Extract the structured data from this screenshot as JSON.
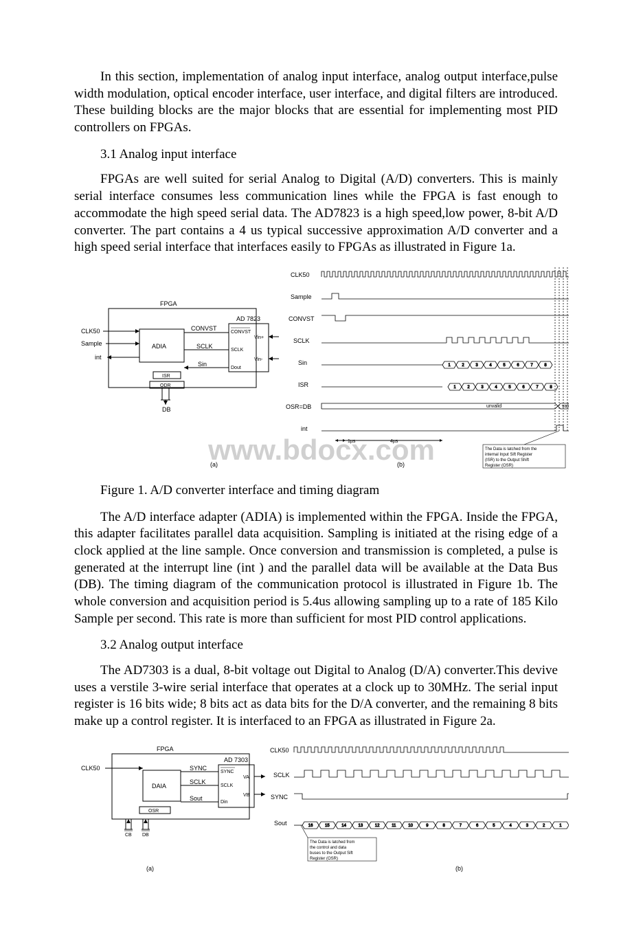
{
  "para_intro": "In this section, implementation of analog input interface, analog output interface,pulse width modulation, optical encoder interface, user interface, and digital filters are introduced. These building blocks are the major blocks that are essential for implementing most PID controllers on FPGAs.",
  "heading_31": "3.1 Analog input interface",
  "para_31": "FPGAs are well suited for serial Analog to Digital (A/D) converters. This is mainly serial interface consumes less communication lines while the FPGA is fast enough to accommodate the high speed serial data. The AD7823 is a high speed,low power, 8-bit A/D converter. The part contains a 4 us typical successive approximation A/D converter and a high speed serial interface that interfaces easily to FPGAs as illustrated in Figure 1a.",
  "fig1_caption": "Figure 1. A/D converter interface and timing diagram",
  "para_31b": "The A/D interface adapter (ADIA) is implemented within the FPGA. Inside the FPGA, this adapter facilitates parallel data acquisition. Sampling is initiated at the rising edge of a clock applied at the line sample. Once conversion and transmission is completed, a pulse is generated at the interrupt line (int ) and the parallel data will be available at the Data Bus (DB). The timing diagram of the communication protocol is illustrated in Figure 1b. The whole conversion and acquisition period is 5.4us allowing sampling up to a rate of 185 Kilo Sample per second. This rate is more than sufficient for most PID control applications.",
  "heading_32": "3.2 Analog output interface",
  "para_32": "The AD7303 is a dual, 8-bit voltage out Digital to Analog (D/A) converter.This devive uses a verstile 3-wire serial interface that operates at a clock up to 30MHz. The serial input register is 16 bits wide; 8 bits act as data bits for the D/A converter, and the remaining 8 bits make up a control register. It is interfaced to an FPGA as illustrated in Figure 2a.",
  "fig1": {
    "watermark": "www.bdocx.com",
    "labels": {
      "fpga": "FPGA",
      "adia": "ADIA",
      "ad7823": "AD 7823",
      "clk50": "CLK50",
      "sample": "Sample",
      "int": "int",
      "convst": "CONVST",
      "convst_bar": "CONVST",
      "sclk": "SCLK",
      "sin": "Sin",
      "isr": "ISR",
      "odr": "ODR",
      "db": "DB",
      "vinp": "Vin+",
      "vinm": "Vin-",
      "dout": "Dout",
      "a": "(a)",
      "b": "(b)",
      "osrdb": "OSR=DB",
      "unvalid": "unvalid",
      "valid": "valid",
      "t1us": "1µs",
      "t4us": "4µs",
      "note1a": "The Data is latched from the",
      "note1b": "internal Input Sift Register",
      "note1c": "(ISR) to the Output Shift",
      "note1d": "Register (OSR)"
    },
    "bits": [
      "1",
      "2",
      "3",
      "4",
      "5",
      "6",
      "7",
      "8"
    ]
  },
  "fig2": {
    "labels": {
      "fpga": "FPGA",
      "daia": "DAIA",
      "ad7303": "AD 7303",
      "clk50": "CLK50",
      "sync": "SYNC",
      "sync_bar": "SYNC",
      "sclk": "SCLK",
      "sout": "Sout",
      "din": "Din",
      "osr": "OSR",
      "va": "VA",
      "vb": "VB",
      "cb": "CB",
      "db": "DB",
      "a": "(a)",
      "b": "(b)",
      "note2a": "The Data is latched from",
      "note2b": "the control and data",
      "note2c": "buses to the Output Sift",
      "note2d": "Register (OSR)"
    },
    "soutbits": [
      "16",
      "15",
      "14",
      "13",
      "12",
      "11",
      "10",
      "9",
      "8",
      "7",
      "6",
      "5",
      "4",
      "3",
      "2",
      "1"
    ]
  }
}
